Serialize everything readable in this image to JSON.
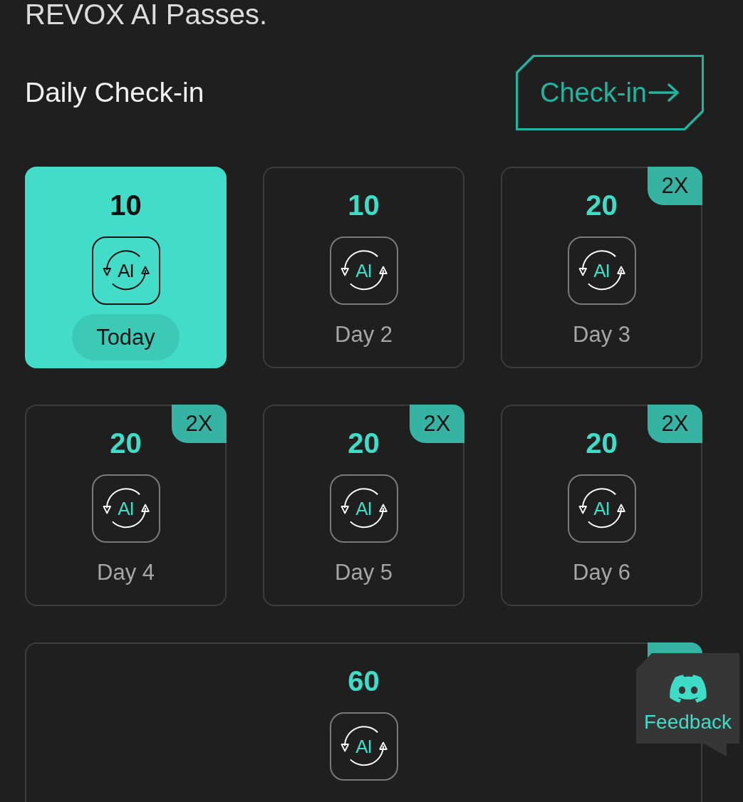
{
  "intro": {
    "text": "REVOX AI Passes."
  },
  "check_in": {
    "title": "Daily Check-in",
    "button": {
      "label": "Check-in"
    },
    "days": [
      {
        "kind": "day",
        "points": "10",
        "token": "AI",
        "label": "Today",
        "selected": true,
        "boosted": false
      },
      {
        "kind": "day",
        "points": "10",
        "token": "AI",
        "label": "Day 2",
        "selected": false,
        "boosted": false
      },
      {
        "kind": "day",
        "points": "20",
        "token": "AI",
        "label": "Day 3",
        "selected": false,
        "boosted": true,
        "badge": "2X"
      },
      {
        "kind": "day",
        "points": "20",
        "token": "AI",
        "label": "Day 4",
        "selected": false,
        "boosted": true,
        "badge": "2X"
      },
      {
        "kind": "day",
        "points": "20",
        "token": "AI",
        "label": "Day 5",
        "selected": false,
        "boosted": true,
        "badge": "2X"
      },
      {
        "kind": "day",
        "points": "20",
        "token": "AI",
        "label": "Day 6",
        "selected": false,
        "boosted": true,
        "badge": "2X"
      },
      {
        "kind": "bonus",
        "points": "60",
        "token": "AI",
        "selected": false,
        "boosted": true
      }
    ]
  },
  "feedback": {
    "label": "Feedback"
  }
}
